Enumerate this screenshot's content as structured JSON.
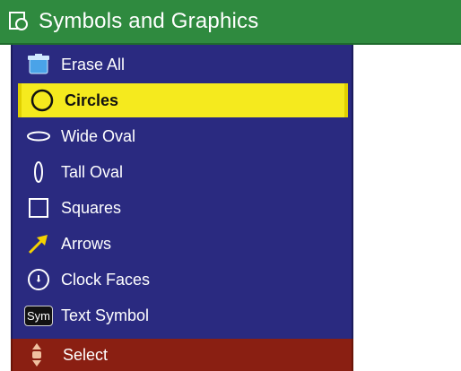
{
  "title_bar": {
    "title": "Symbols and Graphics",
    "icon": "symbols-graphics-icon",
    "color": "#2f8a3f"
  },
  "menu": {
    "background": "#2a2a80",
    "selected_color": "#f5ea1e",
    "selected_index": 1,
    "items": [
      {
        "label": "Erase All",
        "icon": "erase-all-icon"
      },
      {
        "label": "Circles",
        "icon": "circle-icon"
      },
      {
        "label": "Wide Oval",
        "icon": "wide-oval-icon"
      },
      {
        "label": "Tall Oval",
        "icon": "tall-oval-icon"
      },
      {
        "label": "Squares",
        "icon": "square-icon"
      },
      {
        "label": "Arrows",
        "icon": "arrow-icon"
      },
      {
        "label": "Clock Faces",
        "icon": "clock-face-icon"
      },
      {
        "label": "Text Symbol",
        "icon": "text-symbol-icon",
        "icon_text": "Sym"
      }
    ]
  },
  "status_bar": {
    "label": "Select",
    "icon": "up-down-select-icon",
    "color": "#8a1f12"
  }
}
